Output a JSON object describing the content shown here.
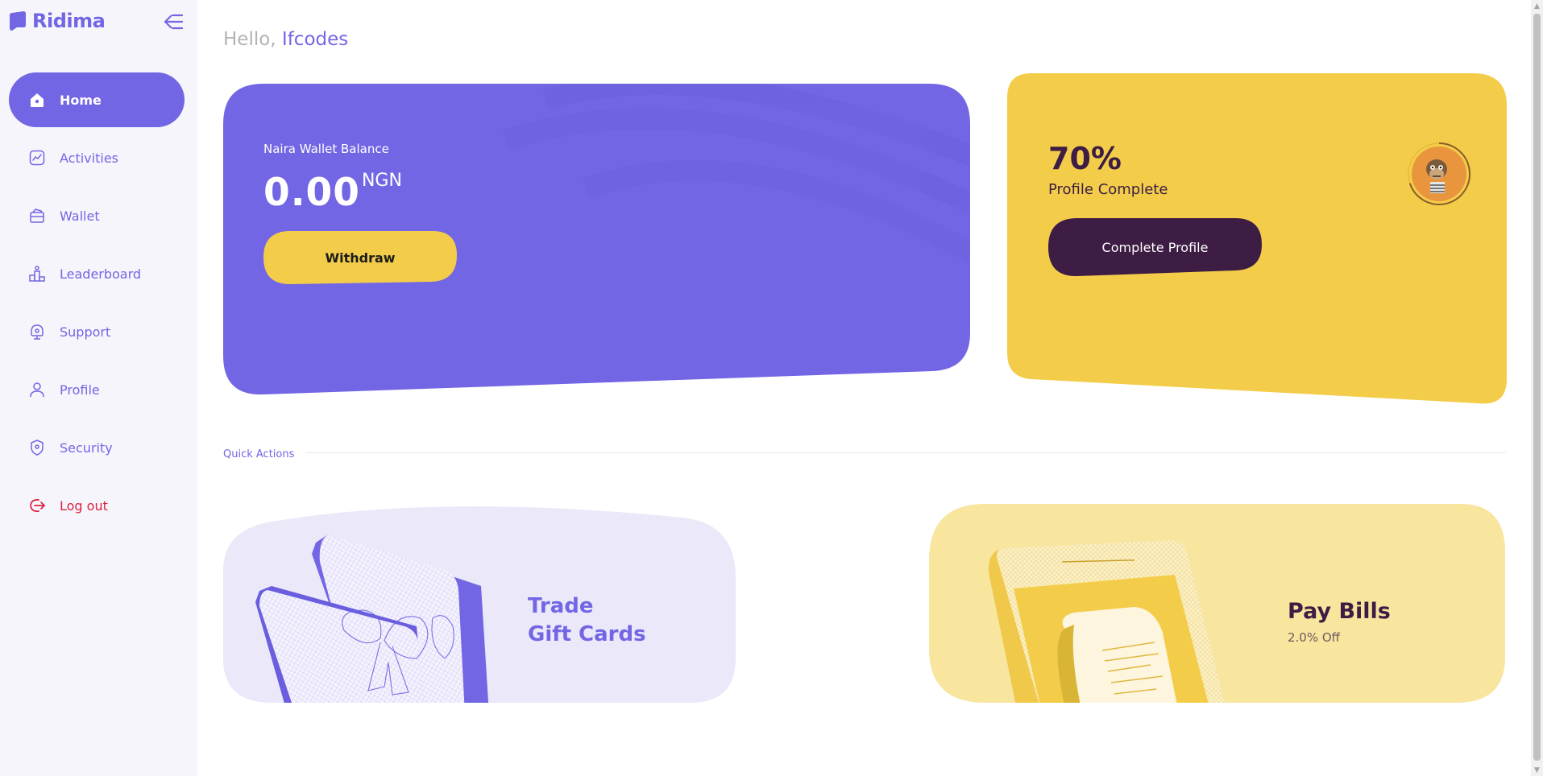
{
  "brand": {
    "name": "Ridima",
    "accent": "#7266e4",
    "yellow": "#f3cd4a",
    "dark": "#3d1d44",
    "danger": "#d9233f"
  },
  "sidebar": {
    "collapse_icon": "menu-collapse-icon",
    "items": [
      {
        "label": "Home",
        "icon": "home-icon",
        "active": true
      },
      {
        "label": "Activities",
        "icon": "activity-chart-icon"
      },
      {
        "label": "Wallet",
        "icon": "wallet-icon"
      },
      {
        "label": "Leaderboard",
        "icon": "leaderboard-icon"
      },
      {
        "label": "Support",
        "icon": "support-icon"
      },
      {
        "label": "Profile",
        "icon": "user-icon"
      },
      {
        "label": "Security",
        "icon": "shield-icon"
      },
      {
        "label": "Log out",
        "icon": "logout-icon"
      }
    ]
  },
  "greeting": {
    "hello": "Hello,",
    "user": "Ifcodes"
  },
  "wallet": {
    "label": "Naira Wallet Balance",
    "amount": "0.00",
    "currency": "NGN",
    "withdraw_label": "Withdraw"
  },
  "profile": {
    "percent_text": "70%",
    "percent_value": 70,
    "label": "Profile Complete",
    "button_label": "Complete Profile"
  },
  "quick_actions": {
    "title": "Quick Actions",
    "gift": {
      "line1": "Trade",
      "line2": "Gift Cards"
    },
    "bills": {
      "title": "Pay Bills",
      "discount": "2.0% Off"
    }
  }
}
